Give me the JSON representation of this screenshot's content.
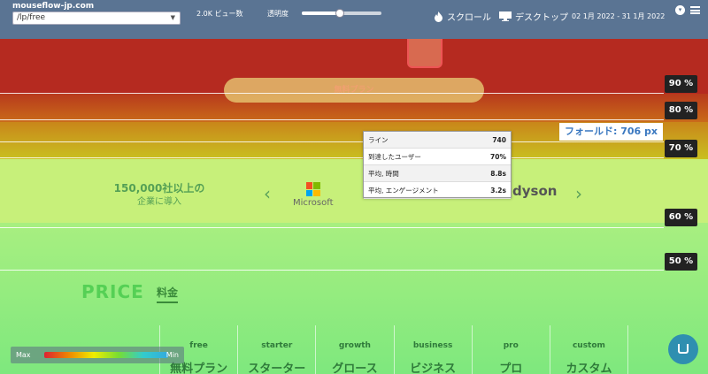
{
  "toolbar": {
    "site": "mouseflow-jp.com",
    "url_select": "/lp/free",
    "views": "2.0K ビュー数",
    "opacity_label": "透明度",
    "opacity_level": 0.48,
    "scroll_label": "スクロール",
    "desktop_label": "デスクトップ",
    "date_range": "02 1月 2022 - 31 1月 2022",
    "icons": [
      "flame-icon",
      "monitor-icon",
      "chevron-down-icon",
      "hamburger-icon"
    ]
  },
  "heatmap": {
    "fold_label": "フォールド: 706 px",
    "markers": [
      "90 %",
      "80 %",
      "70 %",
      "60 %",
      "50 %"
    ],
    "colors": {
      "red": "#b52a20",
      "orange": "#cc5a1a",
      "yellow": "#c9c020",
      "lightgreen": "#c7f07a",
      "green": "#7ee87e"
    }
  },
  "tooltip": {
    "rows": [
      {
        "label": "ライン",
        "value": "740"
      },
      {
        "label": "到達したユーザー",
        "value": "70%"
      },
      {
        "label": "平均, 時間",
        "value": "8.8s"
      },
      {
        "label": "平均, エンゲージメント",
        "value": "3.2s"
      }
    ]
  },
  "page": {
    "free_plan_button": "無料プラン",
    "customers_big": "150,000社以上の",
    "customers_small": "企業に導入",
    "microsoft": "Microsoft",
    "dyson": "dyson",
    "arrow_left": "‹",
    "arrow_right": "›",
    "price_title": "PRICE",
    "price_sub": "料金",
    "plans": [
      {
        "en": "free",
        "jp": "無料プラン"
      },
      {
        "en": "starter",
        "jp": "スターター"
      },
      {
        "en": "growth",
        "jp": "グロース"
      },
      {
        "en": "business",
        "jp": "ビジネス"
      },
      {
        "en": "pro",
        "jp": "プロ"
      },
      {
        "en": "custom",
        "jp": "カスタム"
      }
    ]
  },
  "legend": {
    "max": "Max",
    "min": "Min"
  }
}
